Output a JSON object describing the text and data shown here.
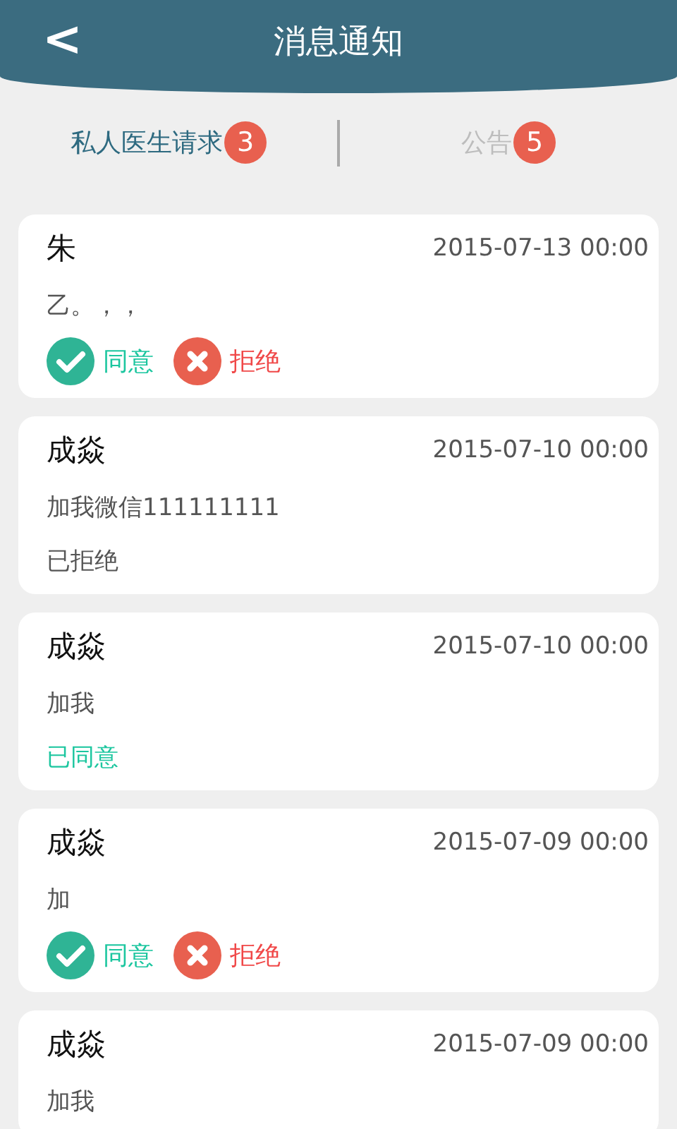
{
  "header": {
    "back": "<",
    "title": "消息通知"
  },
  "tabs": [
    {
      "label": "私人医生请求",
      "badge": "3",
      "selected": true
    },
    {
      "label": "公告",
      "badge": "5",
      "selected": false
    }
  ],
  "messages": [
    {
      "name": "朱",
      "time": "2015-07-13 00:00",
      "text": "乙。，，",
      "kind": "pending",
      "accept": "同意",
      "reject": "拒绝"
    },
    {
      "name": "成焱",
      "time": "2015-07-10 00:00",
      "text": "加我微信111111111",
      "kind": "rejected",
      "status_text": "已拒绝"
    },
    {
      "name": "成焱",
      "time": "2015-07-10 00:00",
      "text": "加我",
      "kind": "accepted",
      "status_text": "已同意"
    },
    {
      "name": "成焱",
      "time": "2015-07-09 00:00",
      "text": "加",
      "kind": "pending",
      "accept": "同意",
      "reject": "拒绝"
    },
    {
      "name": "成焱",
      "time": "2015-07-09 00:00",
      "text": "加我"
    }
  ]
}
